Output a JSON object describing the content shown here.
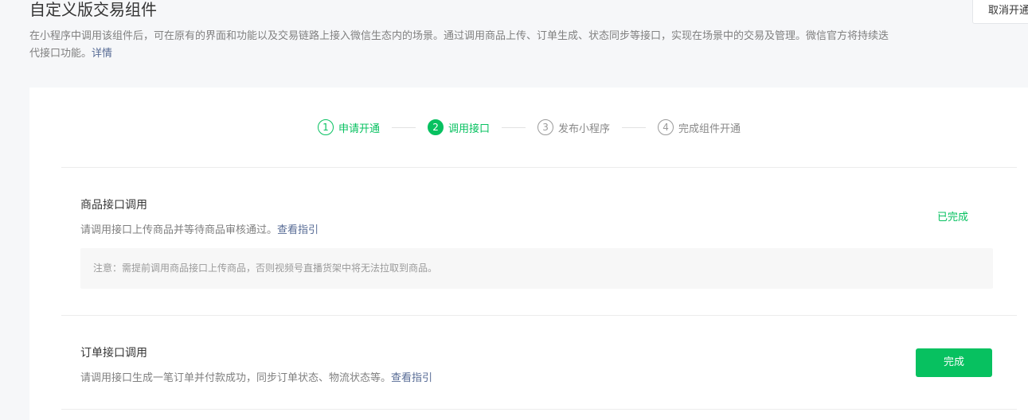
{
  "page": {
    "title": "自定义版交易组件",
    "description": "在小程序中调用该组件后，可在原有的界面和功能以及交易链路上接入微信生态内的场景。通过调用商品上传、订单生成、状态同步等接口，实现在场景中的交易及管理。微信官方将持续迭代接口功能。",
    "description_link": "详情",
    "cancel_button": "取消开通"
  },
  "steps": [
    {
      "num": "1",
      "label": "申请开通",
      "state": "done"
    },
    {
      "num": "2",
      "label": "调用接口",
      "state": "active"
    },
    {
      "num": "3",
      "label": "发布小程序",
      "state": "pending"
    },
    {
      "num": "4",
      "label": "完成组件开通",
      "state": "pending"
    }
  ],
  "sections": {
    "product": {
      "title": "商品接口调用",
      "desc": "请调用接口上传商品并等待商品审核通过。",
      "link": "查看指引",
      "status": "已完成",
      "notice": "注意：需提前调用商品接口上传商品，否则视频号直播货架中将无法拉取到商品。"
    },
    "order": {
      "title": "订单接口调用",
      "desc": "请调用接口生成一笔订单并付款成功，同步订单状态、物流状态等。",
      "link": "查看指引",
      "button": "完成"
    }
  },
  "colors": {
    "accent": "#07c160",
    "link": "#576b95"
  }
}
